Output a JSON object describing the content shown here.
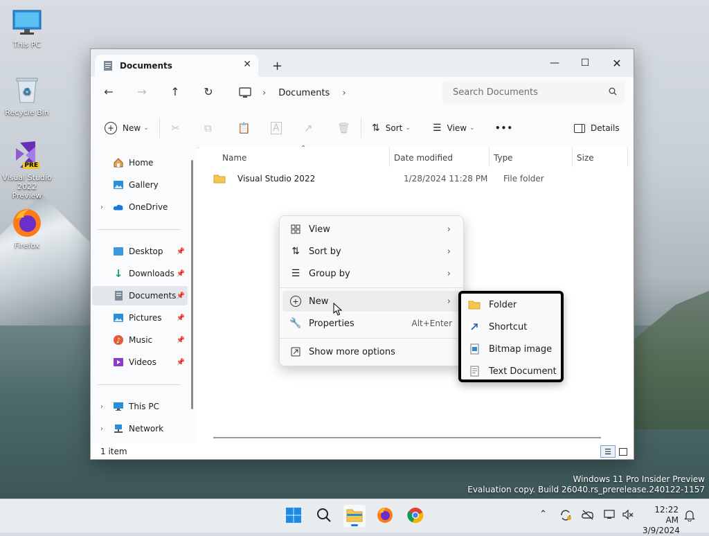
{
  "desktop": {
    "icons": [
      {
        "label": "This PC"
      },
      {
        "label": "Recycle Bin"
      },
      {
        "label": "Visual Studio 2022 Preview"
      },
      {
        "label": "Firefox"
      }
    ],
    "vs_badge": "PRE",
    "watermark": {
      "line1": "Windows 11 Pro Insider Preview",
      "line2": "Evaluation copy. Build 26040.rs_prerelease.240122-1157"
    }
  },
  "window": {
    "tab_title": "Documents",
    "breadcrumb": "Documents",
    "search_placeholder": "Search Documents",
    "toolbar": {
      "new_label": "New",
      "sort_label": "Sort",
      "view_label": "View",
      "more_label": "•••",
      "details_label": "Details"
    },
    "sidebar": {
      "items": [
        {
          "label": "Home"
        },
        {
          "label": "Gallery"
        },
        {
          "label": "OneDrive"
        },
        {
          "label": "Desktop"
        },
        {
          "label": "Downloads"
        },
        {
          "label": "Documents"
        },
        {
          "label": "Pictures"
        },
        {
          "label": "Music"
        },
        {
          "label": "Videos"
        },
        {
          "label": "This PC"
        },
        {
          "label": "Network"
        }
      ]
    },
    "columns": [
      "Name",
      "Date modified",
      "Type",
      "Size"
    ],
    "files": [
      {
        "name": "Visual Studio 2022",
        "date": "1/28/2024 11:28 PM",
        "type": "File folder",
        "size": ""
      }
    ],
    "status": "1 item"
  },
  "context_menu": {
    "items": [
      {
        "label": "View"
      },
      {
        "label": "Sort by"
      },
      {
        "label": "Group by"
      },
      {
        "label": "New"
      },
      {
        "label": "Properties",
        "shortcut": "Alt+Enter"
      },
      {
        "label": "Show more options"
      }
    ]
  },
  "submenu": {
    "items": [
      {
        "label": "Folder"
      },
      {
        "label": "Shortcut"
      },
      {
        "label": "Bitmap image"
      },
      {
        "label": "Text Document"
      }
    ]
  },
  "taskbar": {
    "time": "12:22 AM",
    "date": "3/9/2024"
  }
}
